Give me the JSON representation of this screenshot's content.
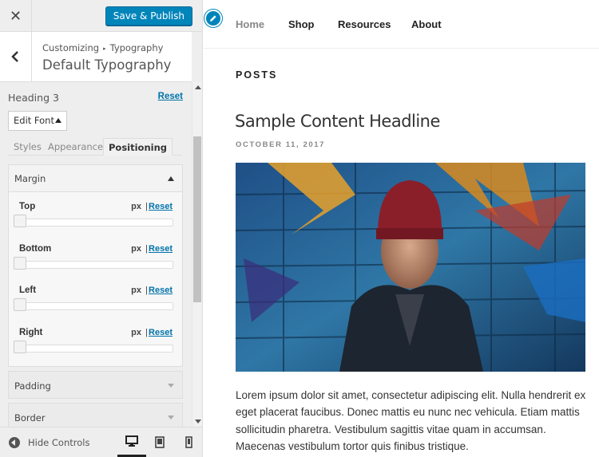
{
  "sidebar": {
    "close_icon": "close-icon",
    "publish_label": "Save & Publish",
    "breadcrumb": {
      "parent": "Customizing",
      "child": "Typography"
    },
    "section_title": "Default Typography",
    "control": {
      "title": "Heading 3",
      "reset_label": "Reset",
      "edit_font_label": "Edit Font",
      "tabs": [
        {
          "label": "Styles",
          "active": false
        },
        {
          "label": "Appearance",
          "active": false
        },
        {
          "label": "Positioning",
          "active": true
        }
      ],
      "margin": {
        "label": "Margin",
        "fields": [
          {
            "label": "Top",
            "unit": "px",
            "separator": "|",
            "reset": "Reset",
            "value": 0
          },
          {
            "label": "Bottom",
            "unit": "px",
            "separator": "|",
            "reset": "Reset",
            "value": 0
          },
          {
            "label": "Left",
            "unit": "px",
            "separator": "|",
            "reset": "Reset",
            "value": 0
          },
          {
            "label": "Right",
            "unit": "px",
            "separator": "|",
            "reset": "Reset",
            "value": 0
          }
        ]
      },
      "collapsed_sections": [
        "Padding",
        "Border"
      ]
    },
    "footer": {
      "hide_controls_label": "Hide Controls",
      "devices": [
        "desktop-icon",
        "tablet-icon",
        "mobile-icon"
      ],
      "active_device": "desktop"
    }
  },
  "preview": {
    "nav": [
      "Home",
      "Shop",
      "Resources",
      "About"
    ],
    "active_nav": "Home",
    "posts_label": "POSTS",
    "post": {
      "headline": "Sample Content Headline",
      "date": "OCTOBER 11, 2017",
      "excerpt": "Lorem ipsum dolor sit amet, consectetur adipiscing elit. Nulla hendrerit ex eget placerat faucibus. Donec mattis eu nunc nec vehicula. Etiam mattis sollicitudin pharetra. Vestibulum sagittis vitae quam in accumsan. Maecenas vestibulum tortor quis finibus tristique."
    }
  },
  "colors": {
    "accent": "#0085ba",
    "link": "#0073aa",
    "sidebar_bg": "#eeeeee"
  }
}
